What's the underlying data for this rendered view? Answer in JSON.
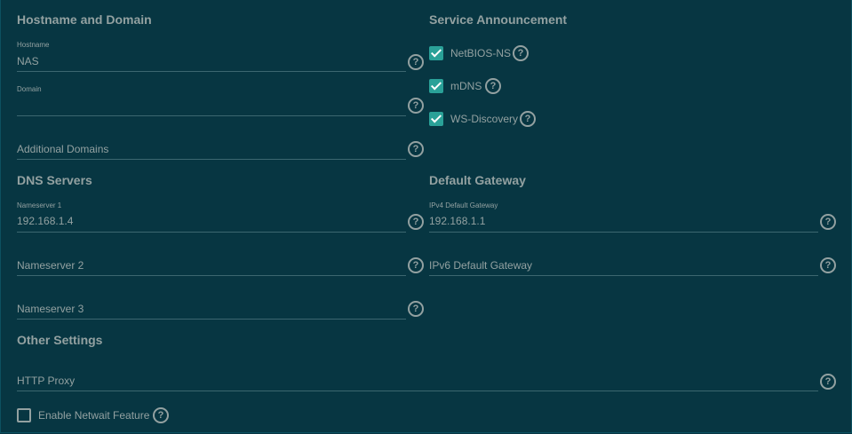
{
  "sections": {
    "hostname_domain": "Hostname and Domain",
    "dns_servers": "DNS Servers",
    "other_settings": "Other Settings",
    "service_announcement": "Service Announcement",
    "default_gateway": "Default Gateway"
  },
  "fields": {
    "hostname": {
      "label": "Hostname",
      "value": "NAS"
    },
    "domain": {
      "label": "Domain",
      "value": ""
    },
    "additional_domains": {
      "placeholder": "Additional Domains"
    },
    "nameserver1": {
      "label": "Nameserver 1",
      "value": "192.168.1.4"
    },
    "nameserver2": {
      "placeholder": "Nameserver 2"
    },
    "nameserver3": {
      "placeholder": "Nameserver 3"
    },
    "ipv4_gateway": {
      "label": "IPv4 Default Gateway",
      "value": "192.168.1.1"
    },
    "ipv6_gateway": {
      "placeholder": "IPv6 Default Gateway"
    },
    "http_proxy": {
      "placeholder": "HTTP Proxy"
    }
  },
  "checkboxes": {
    "netbios": {
      "label": "NetBIOS-NS",
      "checked": true
    },
    "mdns": {
      "label": "mDNS",
      "checked": true
    },
    "wsd": {
      "label": "WS-Discovery",
      "checked": true
    },
    "netwait": {
      "label": "Enable Netwait Feature",
      "checked": false
    }
  },
  "help_glyph": "?",
  "colors": {
    "background": "#073642",
    "text": "#93a1a1",
    "accent": "#2aa198"
  }
}
